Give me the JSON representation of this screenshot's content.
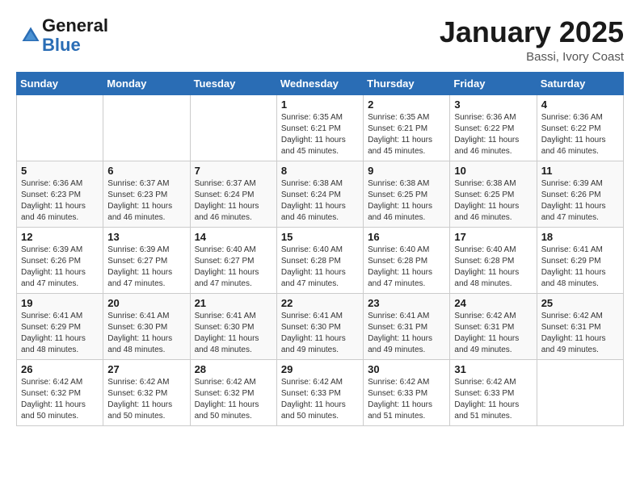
{
  "header": {
    "logo_line1": "General",
    "logo_line2": "Blue",
    "month": "January 2025",
    "location": "Bassi, Ivory Coast"
  },
  "weekdays": [
    "Sunday",
    "Monday",
    "Tuesday",
    "Wednesday",
    "Thursday",
    "Friday",
    "Saturday"
  ],
  "weeks": [
    [
      {
        "day": "",
        "info": ""
      },
      {
        "day": "",
        "info": ""
      },
      {
        "day": "",
        "info": ""
      },
      {
        "day": "1",
        "info": "Sunrise: 6:35 AM\nSunset: 6:21 PM\nDaylight: 11 hours\nand 45 minutes."
      },
      {
        "day": "2",
        "info": "Sunrise: 6:35 AM\nSunset: 6:21 PM\nDaylight: 11 hours\nand 45 minutes."
      },
      {
        "day": "3",
        "info": "Sunrise: 6:36 AM\nSunset: 6:22 PM\nDaylight: 11 hours\nand 46 minutes."
      },
      {
        "day": "4",
        "info": "Sunrise: 6:36 AM\nSunset: 6:22 PM\nDaylight: 11 hours\nand 46 minutes."
      }
    ],
    [
      {
        "day": "5",
        "info": "Sunrise: 6:36 AM\nSunset: 6:23 PM\nDaylight: 11 hours\nand 46 minutes."
      },
      {
        "day": "6",
        "info": "Sunrise: 6:37 AM\nSunset: 6:23 PM\nDaylight: 11 hours\nand 46 minutes."
      },
      {
        "day": "7",
        "info": "Sunrise: 6:37 AM\nSunset: 6:24 PM\nDaylight: 11 hours\nand 46 minutes."
      },
      {
        "day": "8",
        "info": "Sunrise: 6:38 AM\nSunset: 6:24 PM\nDaylight: 11 hours\nand 46 minutes."
      },
      {
        "day": "9",
        "info": "Sunrise: 6:38 AM\nSunset: 6:25 PM\nDaylight: 11 hours\nand 46 minutes."
      },
      {
        "day": "10",
        "info": "Sunrise: 6:38 AM\nSunset: 6:25 PM\nDaylight: 11 hours\nand 46 minutes."
      },
      {
        "day": "11",
        "info": "Sunrise: 6:39 AM\nSunset: 6:26 PM\nDaylight: 11 hours\nand 47 minutes."
      }
    ],
    [
      {
        "day": "12",
        "info": "Sunrise: 6:39 AM\nSunset: 6:26 PM\nDaylight: 11 hours\nand 47 minutes."
      },
      {
        "day": "13",
        "info": "Sunrise: 6:39 AM\nSunset: 6:27 PM\nDaylight: 11 hours\nand 47 minutes."
      },
      {
        "day": "14",
        "info": "Sunrise: 6:40 AM\nSunset: 6:27 PM\nDaylight: 11 hours\nand 47 minutes."
      },
      {
        "day": "15",
        "info": "Sunrise: 6:40 AM\nSunset: 6:28 PM\nDaylight: 11 hours\nand 47 minutes."
      },
      {
        "day": "16",
        "info": "Sunrise: 6:40 AM\nSunset: 6:28 PM\nDaylight: 11 hours\nand 47 minutes."
      },
      {
        "day": "17",
        "info": "Sunrise: 6:40 AM\nSunset: 6:28 PM\nDaylight: 11 hours\nand 48 minutes."
      },
      {
        "day": "18",
        "info": "Sunrise: 6:41 AM\nSunset: 6:29 PM\nDaylight: 11 hours\nand 48 minutes."
      }
    ],
    [
      {
        "day": "19",
        "info": "Sunrise: 6:41 AM\nSunset: 6:29 PM\nDaylight: 11 hours\nand 48 minutes."
      },
      {
        "day": "20",
        "info": "Sunrise: 6:41 AM\nSunset: 6:30 PM\nDaylight: 11 hours\nand 48 minutes."
      },
      {
        "day": "21",
        "info": "Sunrise: 6:41 AM\nSunset: 6:30 PM\nDaylight: 11 hours\nand 48 minutes."
      },
      {
        "day": "22",
        "info": "Sunrise: 6:41 AM\nSunset: 6:30 PM\nDaylight: 11 hours\nand 49 minutes."
      },
      {
        "day": "23",
        "info": "Sunrise: 6:41 AM\nSunset: 6:31 PM\nDaylight: 11 hours\nand 49 minutes."
      },
      {
        "day": "24",
        "info": "Sunrise: 6:42 AM\nSunset: 6:31 PM\nDaylight: 11 hours\nand 49 minutes."
      },
      {
        "day": "25",
        "info": "Sunrise: 6:42 AM\nSunset: 6:31 PM\nDaylight: 11 hours\nand 49 minutes."
      }
    ],
    [
      {
        "day": "26",
        "info": "Sunrise: 6:42 AM\nSunset: 6:32 PM\nDaylight: 11 hours\nand 50 minutes."
      },
      {
        "day": "27",
        "info": "Sunrise: 6:42 AM\nSunset: 6:32 PM\nDaylight: 11 hours\nand 50 minutes."
      },
      {
        "day": "28",
        "info": "Sunrise: 6:42 AM\nSunset: 6:32 PM\nDaylight: 11 hours\nand 50 minutes."
      },
      {
        "day": "29",
        "info": "Sunrise: 6:42 AM\nSunset: 6:33 PM\nDaylight: 11 hours\nand 50 minutes."
      },
      {
        "day": "30",
        "info": "Sunrise: 6:42 AM\nSunset: 6:33 PM\nDaylight: 11 hours\nand 51 minutes."
      },
      {
        "day": "31",
        "info": "Sunrise: 6:42 AM\nSunset: 6:33 PM\nDaylight: 11 hours\nand 51 minutes."
      },
      {
        "day": "",
        "info": ""
      }
    ]
  ]
}
